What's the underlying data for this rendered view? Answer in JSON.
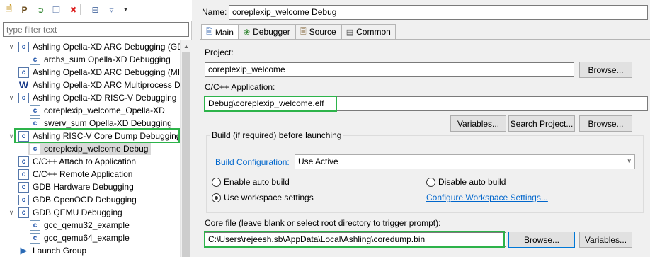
{
  "toolbar": {
    "icons": [
      "new-configuration-icon",
      "new-prototype-icon",
      "export-icon",
      "duplicate-icon",
      "delete-icon",
      "collapse-all-icon",
      "filter-icon",
      "view-menu-icon"
    ]
  },
  "filter": {
    "placeholder": "type filter text"
  },
  "tree": {
    "items": [
      {
        "label": "Ashling Opella-XD ARC Debugging (GD",
        "level": 0,
        "expanded": true
      },
      {
        "label": "archs_sum Opella-XD Debugging",
        "level": 1
      },
      {
        "label": "Ashling Opella-XD ARC Debugging (MI",
        "level": 0
      },
      {
        "label": "Ashling Opella-XD ARC Multiprocess D",
        "level": 0
      },
      {
        "label": "Ashling Opella-XD RISC-V Debugging",
        "level": 0,
        "expanded": true
      },
      {
        "label": "coreplexip_welcome_Opella-XD",
        "level": 1
      },
      {
        "label": "swerv_sum Opella-XD Debugging",
        "level": 1
      },
      {
        "label": "Ashling RISC-V Core Dump Debugging",
        "level": 0,
        "expanded": true,
        "highlighted": true
      },
      {
        "label": "coreplexip_welcome Debug",
        "level": 1,
        "selected": true
      },
      {
        "label": "C/C++ Attach to Application",
        "level": 0
      },
      {
        "label": "C/C++ Remote Application",
        "level": 0
      },
      {
        "label": "GDB Hardware Debugging",
        "level": 0
      },
      {
        "label": "GDB OpenOCD Debugging",
        "level": 0
      },
      {
        "label": "GDB QEMU Debugging",
        "level": 0,
        "expanded": true
      },
      {
        "label": "gcc_qemu32_example",
        "level": 1
      },
      {
        "label": "gcc_qemu64_example",
        "level": 1
      },
      {
        "label": "Launch Group",
        "level": 0
      }
    ]
  },
  "config": {
    "name_label": "Name:",
    "name_value": "coreplexip_welcome Debug",
    "tabs": [
      {
        "label": "Main",
        "icon": "main-tab-icon",
        "active": true
      },
      {
        "label": "Debugger",
        "icon": "debugger-tab-icon"
      },
      {
        "label": "Source",
        "icon": "source-tab-icon"
      },
      {
        "label": "Common",
        "icon": "common-tab-icon"
      }
    ],
    "project_label": "Project:",
    "project_value": "coreplexip_welcome",
    "browse_label": "Browse...",
    "app_label": "C/C++ Application:",
    "app_value": "Debug\\coreplexip_welcome.elf",
    "variables_label": "Variables...",
    "search_project_label": "Search Project...",
    "build_group_title": "Build (if required) before launching",
    "build_config_link": "Build Configuration:",
    "build_config_value": "Use Active",
    "radio_enable_auto": "Enable auto build",
    "radio_disable_auto": "Disable auto build",
    "radio_workspace": "Use workspace settings",
    "configure_workspace_link": "Configure Workspace Settings...",
    "core_file_label": "Core file (leave blank or select root directory to trigger prompt):",
    "core_file_value": "C:\\Users\\rejeesh.sb\\AppData\\Local\\Ashling\\coredump.bin"
  },
  "colors": {
    "highlight": "#2db34a",
    "link": "#0066cc",
    "selection": "#d9d9d9"
  }
}
